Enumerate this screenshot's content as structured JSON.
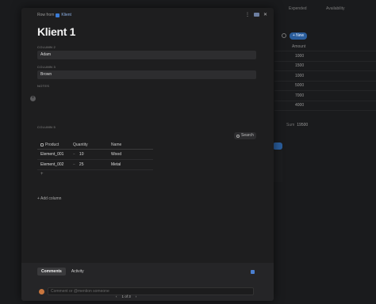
{
  "background": {
    "headers": [
      "Expended",
      "Availability"
    ],
    "new_button": "+ New",
    "amount_header": "Amount",
    "amounts": [
      "1000",
      "1500",
      "1000",
      "5000",
      "7000",
      "4000"
    ],
    "sum_label": "Sum",
    "sum_value": "19500"
  },
  "modal": {
    "breadcrumb_prefix": "Row from",
    "breadcrumb_table": "Klient",
    "title": "Klient 1",
    "fields": [
      {
        "label": "COLUMN 2",
        "value": "Adam"
      },
      {
        "label": "COLUMN 3",
        "value": "Brown"
      }
    ],
    "notes_label": "NOTES",
    "column5_label": "COLUMN 5",
    "search_label": "Search",
    "table": {
      "headers": [
        "Product",
        "Quantity",
        "Name"
      ],
      "rows": [
        {
          "product": "Element_001",
          "quantity": "10",
          "name": "Wood"
        },
        {
          "product": "Element_002",
          "quantity": "25",
          "name": "Metal"
        }
      ]
    },
    "add_column": "+ Add column",
    "footer": {
      "tabs": [
        "Comments",
        "Activity"
      ],
      "comment_placeholder": "Comment or @mention someone",
      "pager": "1 of 3"
    }
  }
}
